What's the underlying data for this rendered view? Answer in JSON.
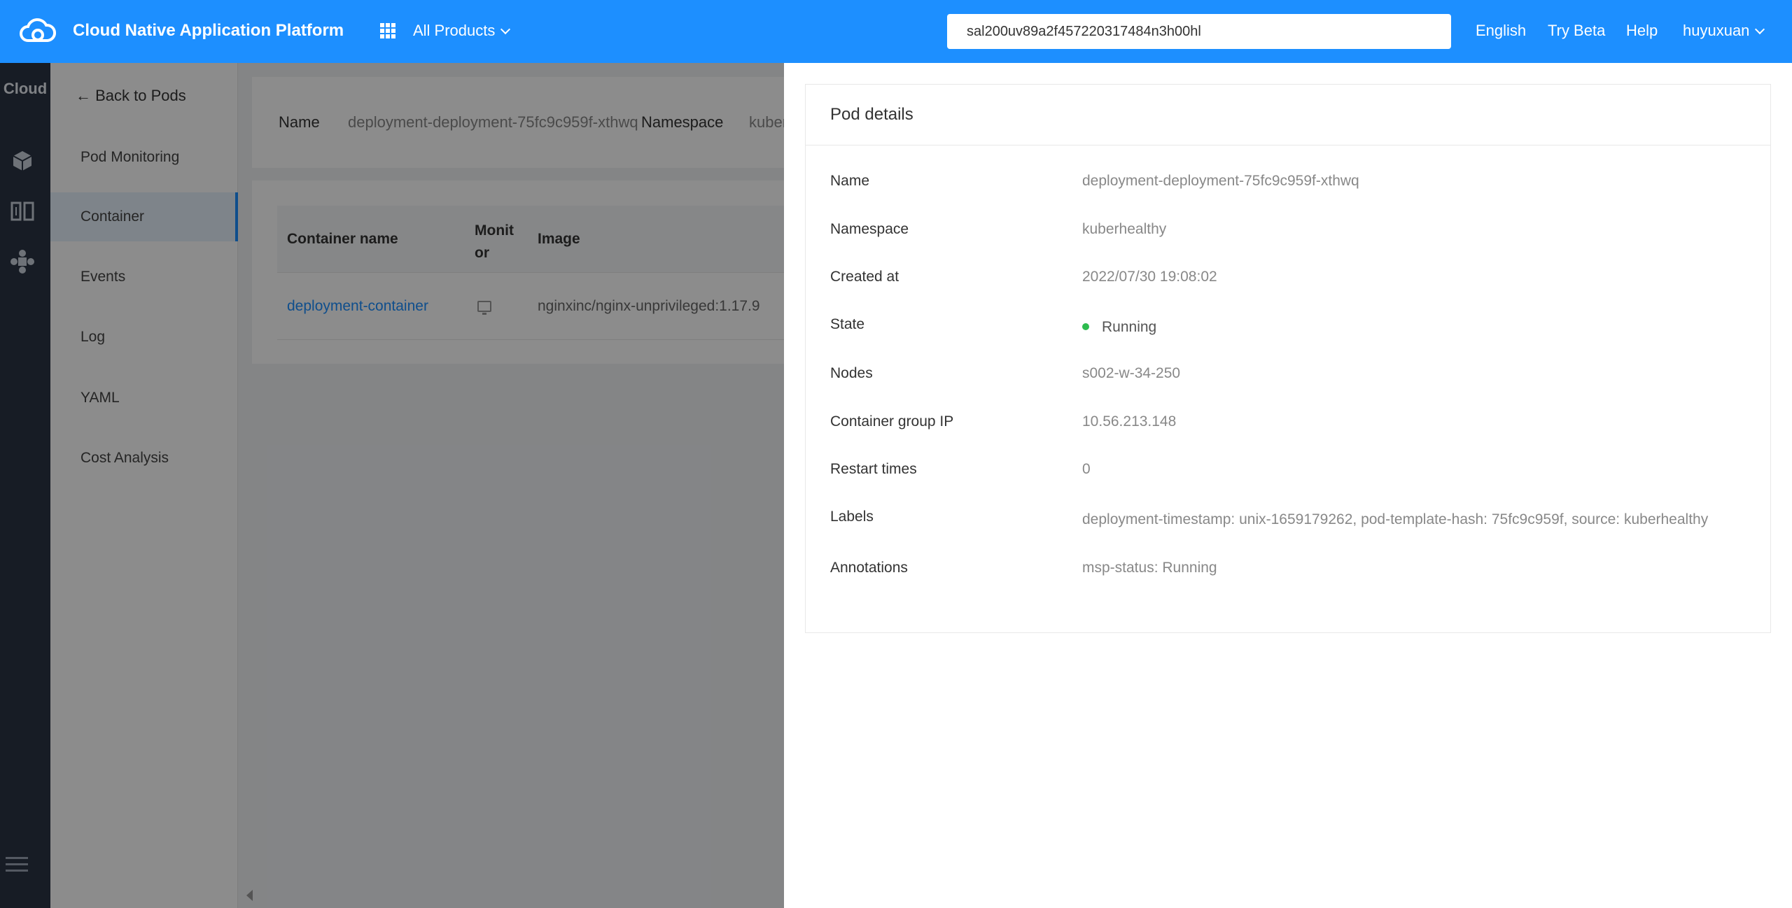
{
  "header": {
    "app_title": "Cloud Native Application Platform",
    "all_products": "All Products",
    "search_value": "sal200uv89a2f457220317484n3h00hl",
    "links": {
      "english": "English",
      "try_beta": "Try Beta",
      "help": "Help",
      "user": "huyuxuan"
    },
    "brand_color": "#1d8fff"
  },
  "rail": {
    "title": "Cloud",
    "icons": [
      "cube-icon",
      "columns-icon",
      "network-icon",
      "menu-icon"
    ]
  },
  "subnav": {
    "back": "← Back to Pods",
    "items": [
      {
        "label": "Pod Monitoring"
      },
      {
        "label": "Container",
        "active": true
      },
      {
        "label": "Events"
      },
      {
        "label": "Log"
      },
      {
        "label": "YAML"
      },
      {
        "label": "Cost Analysis"
      }
    ]
  },
  "main": {
    "name_label": "Name",
    "name_value": "deployment-deployment-75fc9c959f-xthwq",
    "namespace_label": "Namespace",
    "namespace_value": "kuber",
    "table": {
      "headers": [
        "Container name",
        "Monit or",
        "Image"
      ],
      "rows": [
        {
          "name": "deployment-container",
          "image": "nginxinc/nginx-unprivileged:1.17.9"
        }
      ]
    }
  },
  "drawer": {
    "title": "Pod details",
    "fields": [
      {
        "label": "Name",
        "value": "deployment-deployment-75fc9c959f-xthwq"
      },
      {
        "label": "Namespace",
        "value": "kuberhealthy"
      },
      {
        "label": "Created at",
        "value": "2022/07/30 19:08:02"
      },
      {
        "label": "State",
        "value": "Running"
      },
      {
        "label": "Nodes",
        "value": "s002-w-34-250"
      },
      {
        "label": "Container group IP",
        "value": "10.56.213.148"
      },
      {
        "label": "Restart times",
        "value": "0"
      },
      {
        "label": "Labels",
        "value": "deployment-timestamp: unix-1659179262, pod-template-hash: 75fc9c959f, source: kuberhealthy"
      },
      {
        "label": "Annotations",
        "value": "msp-status: Running"
      }
    ],
    "status_color": "#2ebc4f"
  }
}
